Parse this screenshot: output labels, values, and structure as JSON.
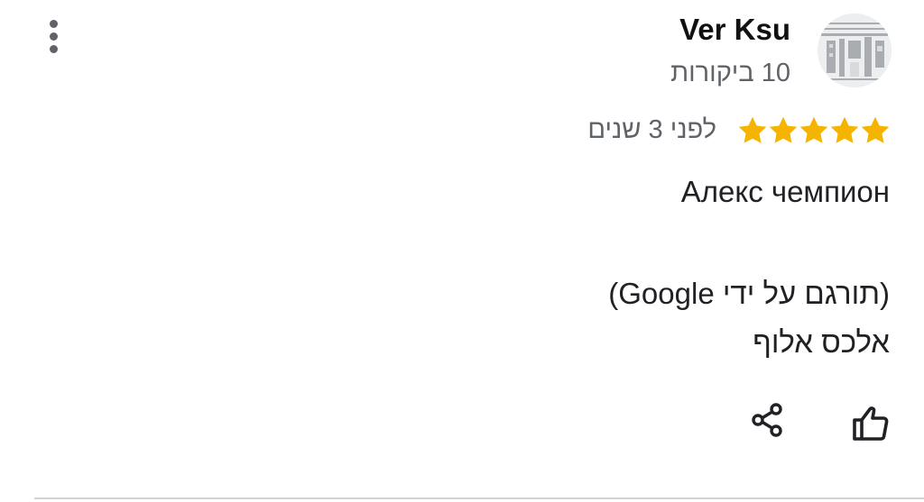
{
  "review": {
    "author": {
      "name": "Ver Ksu",
      "review_count": "10 ביקורות"
    },
    "rating": {
      "value": 5,
      "max": 5,
      "star_color": "#F5B400"
    },
    "time": "לפני 3 שנים",
    "text": "Алекс чемпион",
    "translation_note": "(תורגם על ידי Google)",
    "translated_text": "אלכס אלוף",
    "actions": {
      "share_icon": "share-icon",
      "like_icon": "thumbs-up-icon"
    },
    "menu_icon": "more-vert-icon"
  }
}
